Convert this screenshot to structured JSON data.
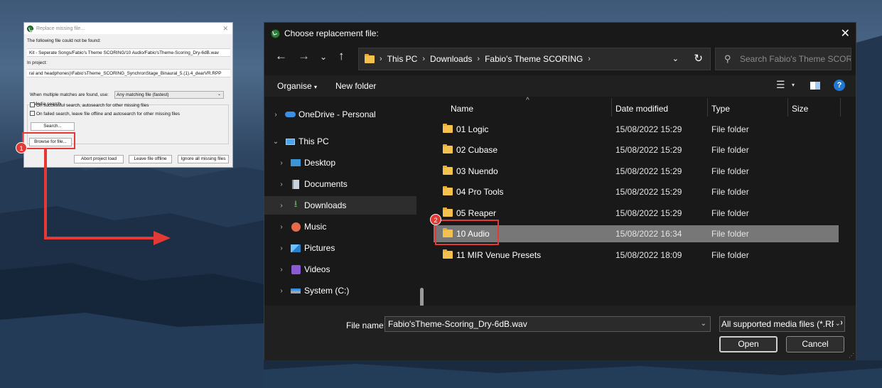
{
  "colors": {
    "accent": "#e53935",
    "selection": "#777777",
    "folder": "#f4c04e"
  },
  "replace_dialog": {
    "title": "Replace missing file...",
    "not_found_label": "The following file could not be found:",
    "missing_path": "Kit - Seperate Songs/Fabio's Theme SCORING/10 Audio/Fabio'sTheme-Scoring_Dry-6dB.wav",
    "in_project_label": "In project:",
    "project_path": "ral and headphones)\\Fabio'sTheme_SCORING_SynchronStage_Binaural_5.(1).4_dearVR.RPP",
    "media_search_label": "Media search",
    "multiple_matches_label": "When multiple matches are found, use:",
    "multiple_matches_value": "Any matching file (fastest)",
    "checkbox1": "On successful search, autosearch for other missing files",
    "checkbox2": "On failed search, leave file offline and autosearch for other missing files",
    "search_button": "Search...",
    "browse_button": "Browse for file...",
    "abort_button": "Abort project load",
    "leave_offline_button": "Leave file offline",
    "ignore_button": "Ignore all missing files"
  },
  "badges": {
    "one": "1",
    "two": "2"
  },
  "file_dialog": {
    "title": "Choose replacement file:",
    "breadcrumb": [
      "This PC",
      "Downloads",
      "Fabio's Theme SCORING"
    ],
    "search_placeholder": "Search Fabio's Theme SCORI...",
    "organise": "Organise",
    "new_folder": "New folder",
    "sidebar": [
      {
        "label": "OneDrive - Personal",
        "icon": "cloud-icon"
      },
      {
        "label": "This PC",
        "icon": "computer-icon"
      },
      {
        "label": "Desktop",
        "icon": "desktop-icon"
      },
      {
        "label": "Documents",
        "icon": "documents-icon"
      },
      {
        "label": "Downloads",
        "icon": "downloads-icon"
      },
      {
        "label": "Music",
        "icon": "music-icon"
      },
      {
        "label": "Pictures",
        "icon": "pictures-icon"
      },
      {
        "label": "Videos",
        "icon": "videos-icon"
      },
      {
        "label": "System (C:)",
        "icon": "drive-icon"
      }
    ],
    "columns": [
      "Name",
      "Date modified",
      "Type",
      "Size"
    ],
    "rows": [
      {
        "name": "01 Logic",
        "date": "15/08/2022 15:29",
        "type": "File folder"
      },
      {
        "name": "02 Cubase",
        "date": "15/08/2022 15:29",
        "type": "File folder"
      },
      {
        "name": "03 Nuendo",
        "date": "15/08/2022 15:29",
        "type": "File folder"
      },
      {
        "name": "04 Pro Tools",
        "date": "15/08/2022 15:29",
        "type": "File folder"
      },
      {
        "name": "05 Reaper",
        "date": "15/08/2022 15:29",
        "type": "File folder"
      },
      {
        "name": "10 Audio",
        "date": "15/08/2022 16:34",
        "type": "File folder"
      },
      {
        "name": "11 MIR Venue Presets",
        "date": "15/08/2022 18:09",
        "type": "File folder"
      }
    ],
    "file_name_label": "File name:",
    "file_name_value": "Fabio'sTheme-Scoring_Dry-6dB.wav",
    "file_type_value": "All supported media files (*.RPP",
    "open_button": "Open",
    "cancel_button": "Cancel"
  }
}
